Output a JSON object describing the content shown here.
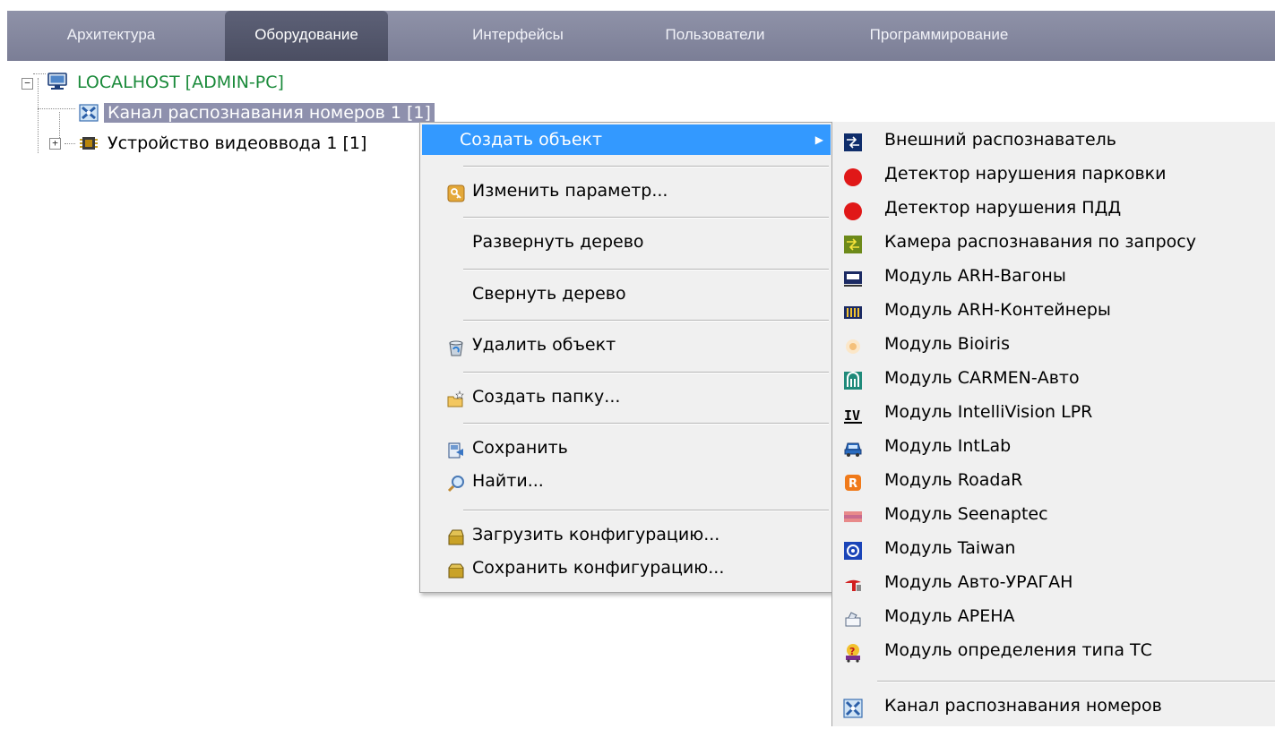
{
  "tabs": [
    {
      "label": "Архитектура"
    },
    {
      "label": "Оборудование"
    },
    {
      "label": "Интерфейсы"
    },
    {
      "label": "Пользователи"
    },
    {
      "label": "Программирование"
    }
  ],
  "tree": {
    "root": {
      "label": "LOCALHOST [ADMIN-PC]",
      "icon": "monitor-icon",
      "color": "#1a8a3a"
    },
    "children": [
      {
        "label": "Канал распознавания номеров 1 [1]",
        "icon": "recognition-channel-icon"
      },
      {
        "label": "Устройство видеоввода 1 [1]",
        "icon": "chip-icon"
      }
    ]
  },
  "context_menu": {
    "items": [
      {
        "label": "Создать объект",
        "icon": "",
        "has_submenu": true
      },
      {
        "label": "Изменить параметр...",
        "icon": "key-icon"
      },
      {
        "label": "Развернуть дерево",
        "icon": ""
      },
      {
        "label": "Свернуть дерево",
        "icon": ""
      },
      {
        "label": "Удалить объект",
        "icon": "recycle-bin-icon"
      },
      {
        "label": "Создать папку...",
        "icon": "new-folder-icon"
      },
      {
        "label": "Сохранить",
        "icon": "save-icon"
      },
      {
        "label": "Найти...",
        "icon": "magnifier-icon"
      },
      {
        "label": "Загрузить конфигурацию...",
        "icon": "load-config-box-icon"
      },
      {
        "label": "Сохранить конфигурацию...",
        "icon": "save-config-box-icon"
      }
    ],
    "highlight_color": "#3399ff"
  },
  "submenu": {
    "items": [
      {
        "label": "Внешний распознаватель",
        "icon": "external-recognizer-icon"
      },
      {
        "label": "Детектор нарушения парковки",
        "icon": "red-circle-icon"
      },
      {
        "label": "Детектор нарушения ПДД",
        "icon": "red-circle-icon"
      },
      {
        "label": "Камера распознавания по запросу",
        "icon": "request-camera-icon"
      },
      {
        "label": "Модуль ARH-Вагоны",
        "icon": "wagon-icon"
      },
      {
        "label": "Модуль ARH-Контейнеры",
        "icon": "container-icon"
      },
      {
        "label": "Модуль Bioiris",
        "icon": "bioiris-icon"
      },
      {
        "label": "Модуль CARMEN-Авто",
        "icon": "carmen-icon"
      },
      {
        "label": "Модуль IntelliVision LPR",
        "icon": "intellivision-icon"
      },
      {
        "label": "Модуль IntLab",
        "icon": "intlab-car-icon"
      },
      {
        "label": "Модуль RoadaR",
        "icon": "roadar-icon"
      },
      {
        "label": "Модуль Seenaptec",
        "icon": "seenaptec-icon"
      },
      {
        "label": "Модуль Taiwan",
        "icon": "taiwan-icon"
      },
      {
        "label": "Модуль Авто-УРАГАН",
        "icon": "uragan-icon"
      },
      {
        "label": "Модуль АРЕНА",
        "icon": "arena-icon"
      },
      {
        "label": "Модуль определения типа ТС",
        "icon": "vehicle-type-icon"
      },
      {
        "label": "Канал распознавания номеров",
        "icon": "recognition-channel-icon"
      }
    ]
  }
}
